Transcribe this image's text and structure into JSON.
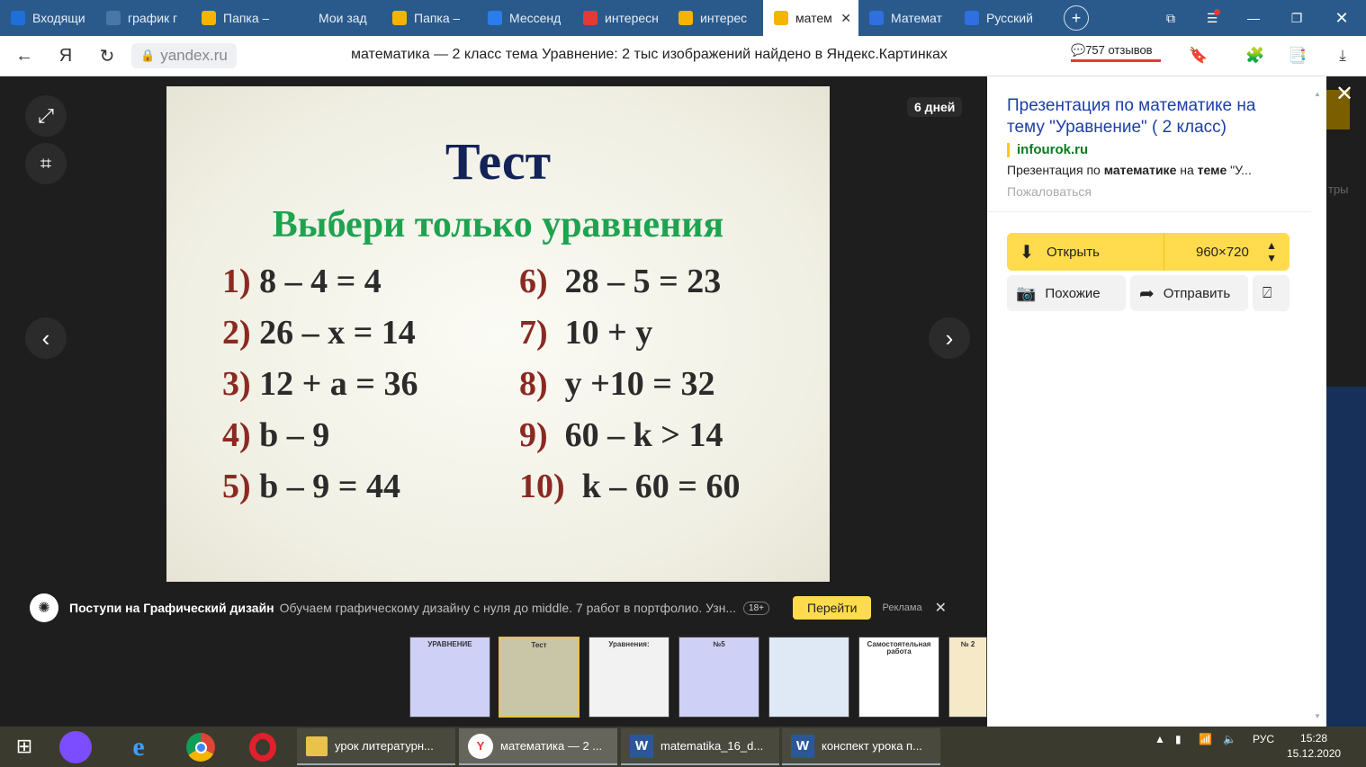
{
  "browser": {
    "tabs": [
      {
        "label": "Входящи",
        "icon": "mail-icon",
        "color": "#1e6fd9"
      },
      {
        "label": "график г",
        "icon": "vk-icon",
        "color": "#4a76a8"
      },
      {
        "label": "Папка –",
        "icon": "drive-icon",
        "color": "#f4b400"
      },
      {
        "label": "Мои зад",
        "icon": "target-icon",
        "color": "#2a5a8c"
      },
      {
        "label": "Папка –",
        "icon": "drive-icon",
        "color": "#f4b400"
      },
      {
        "label": "Мессенд",
        "icon": "messenger-icon",
        "color": "#2b7de9"
      },
      {
        "label": "интересн",
        "icon": "yandex-icon",
        "color": "#e53935"
      },
      {
        "label": "интерес",
        "icon": "images-icon",
        "color": "#f4b400"
      },
      {
        "label": "матем",
        "icon": "images-icon",
        "color": "#f4b400",
        "active": true
      },
      {
        "label": "Математ",
        "icon": "bookmark-icon",
        "color": "#2f6fe0"
      },
      {
        "label": "Русский",
        "icon": "bookmark-icon",
        "color": "#2f6fe0"
      }
    ],
    "url": "yandex.ru",
    "page_title": "математика — 2 класс тема Уравнение: 2 тыс изображений найдено в Яндекс.Картинках",
    "reviews": "757 отзывов"
  },
  "viewer": {
    "days_badge": "6 дней",
    "slide": {
      "title": "Тест",
      "subtitle": "Выбери только уравнения",
      "left": [
        {
          "n": "1)",
          "expr": "8 – 4 = 4"
        },
        {
          "n": "2)",
          "expr": "26 – x = 14"
        },
        {
          "n": "3)",
          "expr": "12 + a = 36"
        },
        {
          "n": "4)",
          "expr": "b – 9"
        },
        {
          "n": "5)",
          "expr": "b – 9 = 44"
        }
      ],
      "right": [
        {
          "n": "6)",
          "expr": "28 – 5 = 23"
        },
        {
          "n": "7)",
          "expr": "10 + y"
        },
        {
          "n": "8)",
          "expr": "y +10 = 32"
        },
        {
          "n": "9)",
          "expr": "60 – k > 14"
        },
        {
          "n": "10)",
          "expr": "k – 60 = 60"
        }
      ]
    }
  },
  "ad": {
    "title": "Поступи на Графический дизайн",
    "text": "Обучаем графическому дизайну с нуля до middle. 7 работ в портфолио. Узн...",
    "age": "18+",
    "cta": "Перейти",
    "label": "Реклама"
  },
  "thumbs": [
    {
      "title": "УРАВНЕНИЕ",
      "bg": "#cfd0f5"
    },
    {
      "title": "Тест",
      "bg": "#c9c6a8"
    },
    {
      "title": "Уравнения:",
      "bg": "#f2f2f2"
    },
    {
      "title": "№5",
      "bg": "#cfd0f5"
    },
    {
      "title": "",
      "bg": "#dfe8f5"
    },
    {
      "title": "Самостоятельная работа",
      "bg": "#ffffff"
    },
    {
      "title": "№ 2",
      "bg": "#f5e9c8"
    }
  ],
  "panel": {
    "link": "Презентация по математике на тему \"Уравнение\" ( 2 класс)",
    "domain": "infourok.ru",
    "desc_plain1": "Презентация по ",
    "desc_bold1": "математике",
    "desc_plain2": " на ",
    "desc_bold2": "теме",
    "desc_plain3": " \"У...",
    "complain": "Пожаловаться",
    "open": "Открыть",
    "size": "960×720",
    "similar": "Похожие",
    "send": "Отправить"
  },
  "taskbar": {
    "windows": [
      {
        "label": "урок литературн...",
        "icon": "folder-icon"
      },
      {
        "label": "математика — 2 ...",
        "icon": "yandex-browser-icon",
        "active": true
      },
      {
        "label": "matematika_16_d...",
        "icon": "word-icon"
      },
      {
        "label": "конспект урока п...",
        "icon": "word-icon"
      }
    ],
    "lang": "РУС",
    "time": "15:28",
    "date": "15.12.2020"
  }
}
